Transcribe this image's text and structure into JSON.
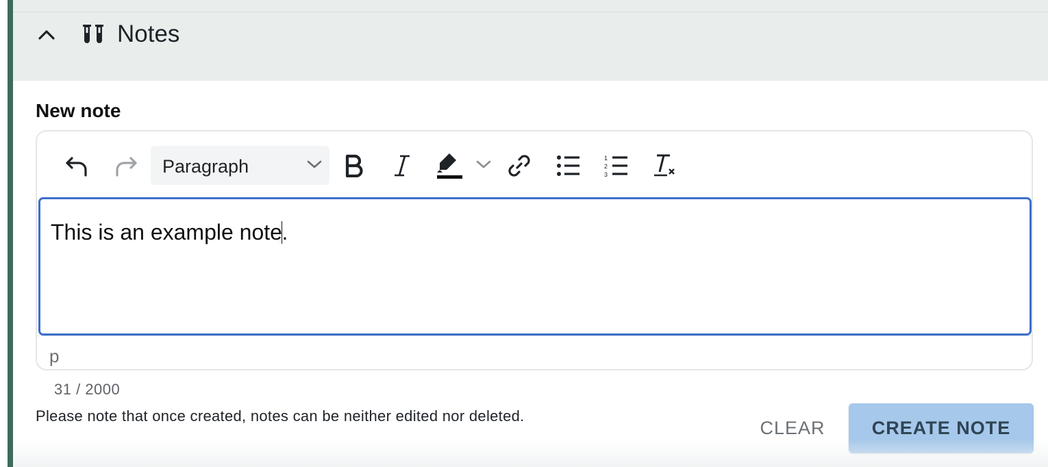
{
  "section": {
    "title": "Notes",
    "icon": "test-tubes-icon",
    "collapse_icon": "chevron-up-icon"
  },
  "new_note": {
    "label": "New note",
    "toolbar": {
      "undo_icon": "undo-icon",
      "redo_icon": "redo-icon",
      "block_format": "Paragraph",
      "bold_icon": "bold-icon",
      "italic_icon": "italic-icon",
      "highlight_icon": "highlighter-icon",
      "link_icon": "link-icon",
      "bullet_list_icon": "bullet-list-icon",
      "numbered_list_icon": "numbered-list-icon",
      "clear_format_icon": "clear-formatting-icon"
    },
    "content": "This is an example note",
    "content_tail": ".",
    "status_path": "p",
    "counter": "31 / 2000"
  },
  "disclaimer": "Please note that once created, notes can be neither edited nor deleted.",
  "actions": {
    "clear_label": "CLEAR",
    "create_label": "CREATE NOTE"
  },
  "colors": {
    "accent_bar": "#3d6b5c",
    "focus_border": "#3b6fc9",
    "primary_button": "#a6c8ea"
  }
}
